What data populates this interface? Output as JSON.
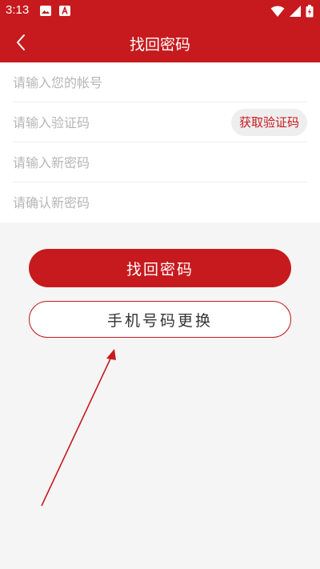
{
  "status_bar": {
    "time": "3:13"
  },
  "header": {
    "title": "找回密码"
  },
  "form": {
    "account_placeholder": "请输入您的帐号",
    "code_placeholder": "请输入验证码",
    "get_code_label": "获取验证码",
    "new_password_placeholder": "请输入新密码",
    "confirm_password_placeholder": "请确认新密码"
  },
  "actions": {
    "recover_label": "找回密码",
    "change_phone_label": "手机号码更换"
  },
  "colors": {
    "accent": "#c71a1e",
    "background": "#f5f5f5",
    "arrow": "#c71a1e"
  }
}
